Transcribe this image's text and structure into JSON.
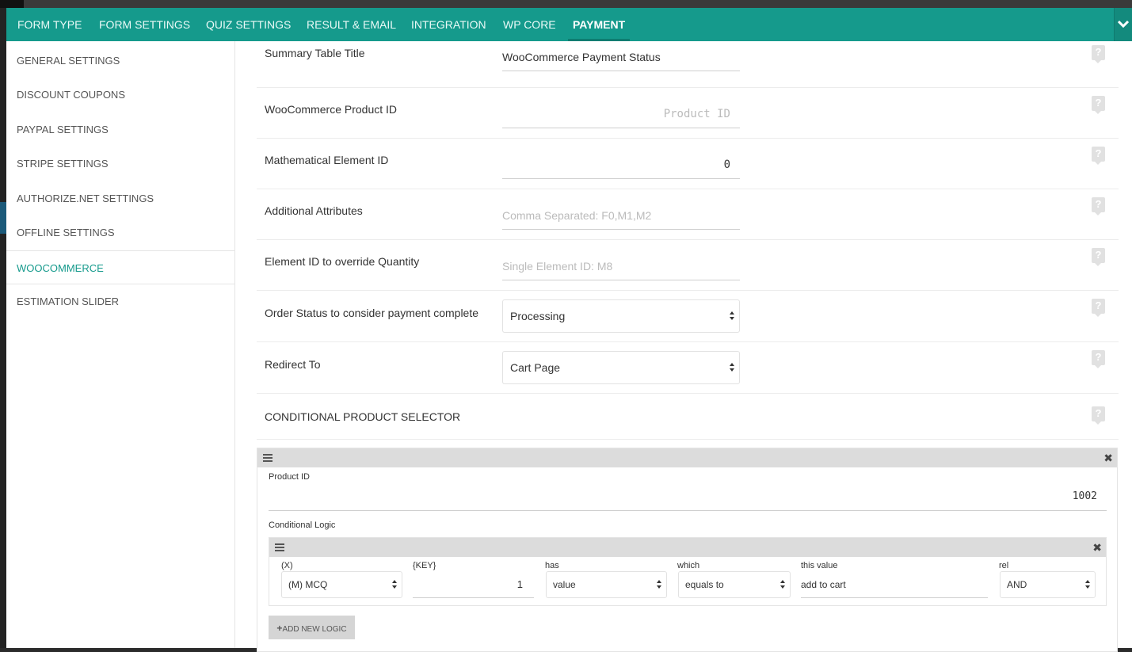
{
  "tabs": [
    {
      "label": "FORM TYPE"
    },
    {
      "label": "FORM SETTINGS"
    },
    {
      "label": "QUIZ SETTINGS"
    },
    {
      "label": "RESULT & EMAIL"
    },
    {
      "label": "INTEGRATION"
    },
    {
      "label": "WP CORE"
    },
    {
      "label": "PAYMENT"
    }
  ],
  "active_tab": "PAYMENT",
  "sidebar": {
    "items": [
      {
        "label": "GENERAL SETTINGS"
      },
      {
        "label": "DISCOUNT COUPONS"
      },
      {
        "label": "PAYPAL SETTINGS"
      },
      {
        "label": "STRIPE SETTINGS"
      },
      {
        "label": "AUTHORIZE.NET SETTINGS"
      },
      {
        "label": "OFFLINE SETTINGS"
      },
      {
        "label": "WOOCOMMERCE"
      },
      {
        "label": "ESTIMATION SLIDER"
      }
    ],
    "active": "WOOCOMMERCE"
  },
  "settings": {
    "summary_title": {
      "label": "Summary Table Title",
      "value": "WooCommerce Payment Status"
    },
    "product_id": {
      "label": "WooCommerce Product ID",
      "value": "",
      "placeholder": "Product ID"
    },
    "math_element": {
      "label": "Mathematical Element ID",
      "value": "0"
    },
    "additional_attributes": {
      "label": "Additional Attributes",
      "value": "",
      "placeholder": "Comma Separated: F0,M1,M2"
    },
    "override_quantity": {
      "label": "Element ID to override Quantity",
      "value": "",
      "placeholder": "Single Element ID: M8"
    },
    "order_status": {
      "label": "Order Status to consider payment complete",
      "selected": "Processing"
    },
    "redirect": {
      "label": "Redirect To",
      "selected": "Cart Page"
    },
    "conditional_selector": {
      "label": "CONDITIONAL PRODUCT SELECTOR"
    }
  },
  "help_icon_text": "?",
  "product_block": {
    "product_id_label": "Product ID",
    "product_id_value": "1002",
    "conditional_logic_label": "Conditional Logic",
    "logic": {
      "x_label": "(X)",
      "x_value": "(M) MCQ",
      "key_label": "{KEY}",
      "key_value": "1",
      "has_label": "has",
      "has_value": "value",
      "which_label": "which",
      "which_value": "equals to",
      "this_value_label": "this value",
      "this_value": "add to cart",
      "rel_label": "rel",
      "rel_value": "AND"
    },
    "add_logic_button": "ADD NEW LOGIC",
    "add_icon": "+"
  },
  "colors": {
    "accent": "#159a8c"
  }
}
